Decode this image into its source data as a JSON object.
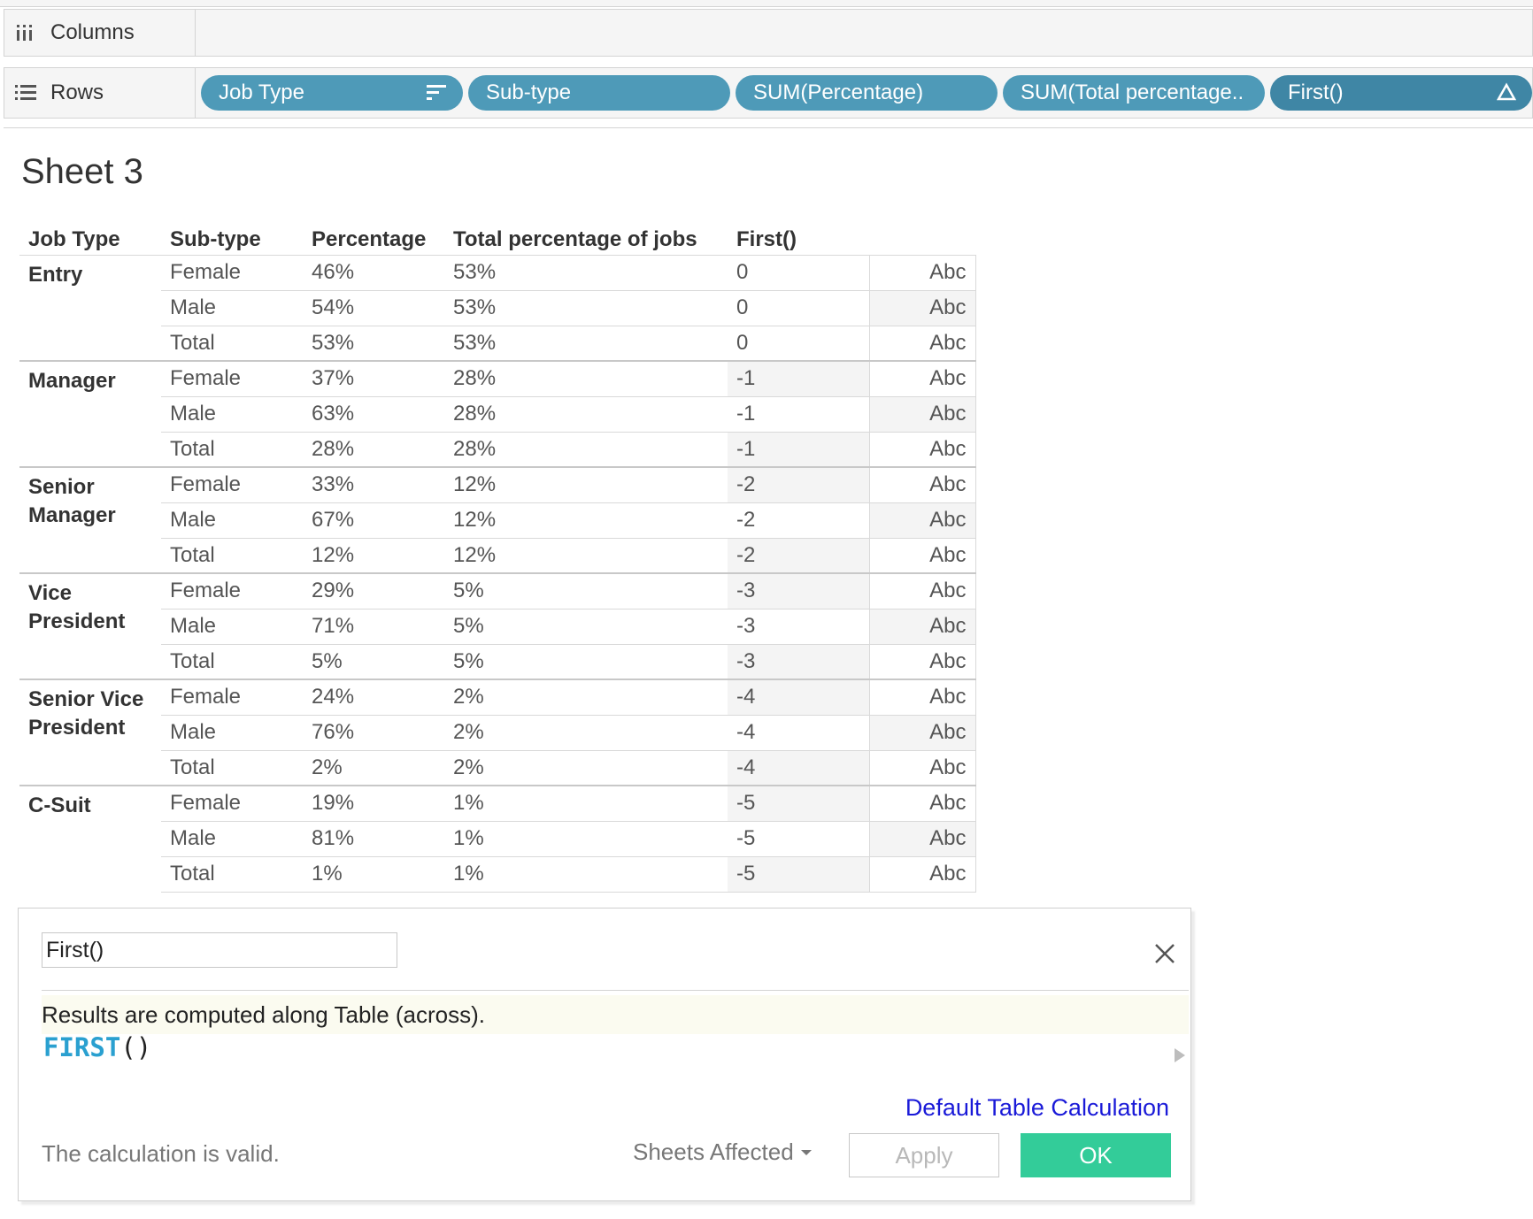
{
  "shelves": {
    "columns_label": "Columns",
    "rows_label": "Rows",
    "row_pills": [
      {
        "label": "Job Type",
        "icon": "sort-icon"
      },
      {
        "label": "Sub-type"
      },
      {
        "label": "SUM(Percentage)"
      },
      {
        "label": "SUM(Total percentage.."
      },
      {
        "label": "First()",
        "icon": "delta-icon"
      }
    ]
  },
  "sheet": {
    "title": "Sheet 3",
    "headers": [
      "Job Type",
      "Sub-type",
      "Percentage",
      "Total percentage of jobs",
      "First()"
    ],
    "groups": [
      {
        "job_type": "Entry",
        "rows": [
          {
            "sub": "Female",
            "pct": "46%",
            "total": "53%",
            "first": "0",
            "abc": "Abc"
          },
          {
            "sub": "Male",
            "pct": "54%",
            "total": "53%",
            "first": "0",
            "abc": "Abc"
          },
          {
            "sub": "Total",
            "pct": "53%",
            "total": "53%",
            "first": "0",
            "abc": "Abc"
          }
        ]
      },
      {
        "job_type": "Manager",
        "rows": [
          {
            "sub": "Female",
            "pct": "37%",
            "total": "28%",
            "first": "-1",
            "abc": "Abc"
          },
          {
            "sub": "Male",
            "pct": "63%",
            "total": "28%",
            "first": "-1",
            "abc": "Abc"
          },
          {
            "sub": "Total",
            "pct": "28%",
            "total": "28%",
            "first": "-1",
            "abc": "Abc"
          }
        ]
      },
      {
        "job_type": "Senior Manager",
        "rows": [
          {
            "sub": "Female",
            "pct": "33%",
            "total": "12%",
            "first": "-2",
            "abc": "Abc"
          },
          {
            "sub": "Male",
            "pct": "67%",
            "total": "12%",
            "first": "-2",
            "abc": "Abc"
          },
          {
            "sub": "Total",
            "pct": "12%",
            "total": "12%",
            "first": "-2",
            "abc": "Abc"
          }
        ]
      },
      {
        "job_type": "Vice President",
        "rows": [
          {
            "sub": "Female",
            "pct": "29%",
            "total": "5%",
            "first": "-3",
            "abc": "Abc"
          },
          {
            "sub": "Male",
            "pct": "71%",
            "total": "5%",
            "first": "-3",
            "abc": "Abc"
          },
          {
            "sub": "Total",
            "pct": "5%",
            "total": "5%",
            "first": "-3",
            "abc": "Abc"
          }
        ]
      },
      {
        "job_type": "Senior Vice President",
        "rows": [
          {
            "sub": "Female",
            "pct": "24%",
            "total": "2%",
            "first": "-4",
            "abc": "Abc"
          },
          {
            "sub": "Male",
            "pct": "76%",
            "total": "2%",
            "first": "-4",
            "abc": "Abc"
          },
          {
            "sub": "Total",
            "pct": "2%",
            "total": "2%",
            "first": "-4",
            "abc": "Abc"
          }
        ]
      },
      {
        "job_type": "C-Suit",
        "rows": [
          {
            "sub": "Female",
            "pct": "19%",
            "total": "1%",
            "first": "-5",
            "abc": "Abc"
          },
          {
            "sub": "Male",
            "pct": "81%",
            "total": "1%",
            "first": "-5",
            "abc": "Abc"
          },
          {
            "sub": "Total",
            "pct": "1%",
            "total": "1%",
            "first": "-5",
            "abc": "Abc"
          }
        ]
      }
    ]
  },
  "calc_dialog": {
    "name_value": "First()",
    "result_text": "Results are computed along Table (across).",
    "formula_keyword": "FIRST",
    "formula_parens": "()",
    "default_link": "Default Table Calculation",
    "status": "The calculation is valid.",
    "sheets_affected": "Sheets Affected",
    "apply_label": "Apply",
    "ok_label": "OK"
  },
  "colors": {
    "pill": "#4e9ab8",
    "ok_button": "#33cc99",
    "link": "#1a1ad8",
    "formula_keyword": "#2aa0d0"
  }
}
